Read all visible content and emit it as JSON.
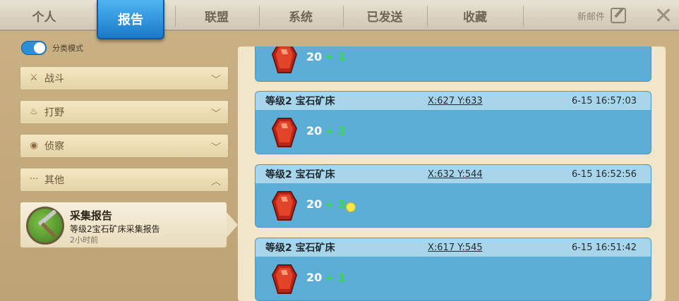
{
  "tabs": {
    "personal": "个人",
    "reports": "报告",
    "alliance": "联盟",
    "system": "系统",
    "sent": "已发送",
    "favorites": "收藏"
  },
  "compose": {
    "label": "新邮件",
    "icon": "edit-icon"
  },
  "close": {
    "icon": "close-icon",
    "glyph": "✕"
  },
  "sidebar": {
    "toggle_label": "分类模式",
    "categories": [
      {
        "label": "战斗",
        "icon": "battle-icon",
        "glyph": "⚔",
        "expanded": false
      },
      {
        "label": "打野",
        "icon": "hunt-icon",
        "glyph": "♨",
        "expanded": false
      },
      {
        "label": "侦察",
        "icon": "scout-eye-icon",
        "glyph": "◉",
        "expanded": false
      },
      {
        "label": "其他",
        "icon": "more-dots-icon",
        "glyph": "···",
        "expanded": true
      }
    ],
    "selected_report": {
      "title": "采集报告",
      "subtitle": "等级2宝石矿床采集报告",
      "time": "2小时前"
    }
  },
  "reports": [
    {
      "name": "",
      "coords": "",
      "time": "",
      "amount": "20",
      "bonus": "+ 1"
    },
    {
      "name": "等级2 宝石矿床",
      "coords": "X:627 Y:633",
      "time": "6-15 16:57:03",
      "amount": "20",
      "bonus": "+ 3"
    },
    {
      "name": "等级2 宝石矿床",
      "coords": "X:632 Y:544",
      "time": "6-15 16:52:56",
      "amount": "20",
      "bonus": "+ 3"
    },
    {
      "name": "等级2 宝石矿床",
      "coords": "X:617 Y:545",
      "time": "6-15 16:51:42",
      "amount": "20",
      "bonus": "+ 1"
    }
  ],
  "colors": {
    "active_tab": "#1b78c8",
    "entry_bg": "#5daed6",
    "entry_header": "#a8d5ea",
    "bonus_green": "#36d84a",
    "gem_red": "#d4341c"
  }
}
